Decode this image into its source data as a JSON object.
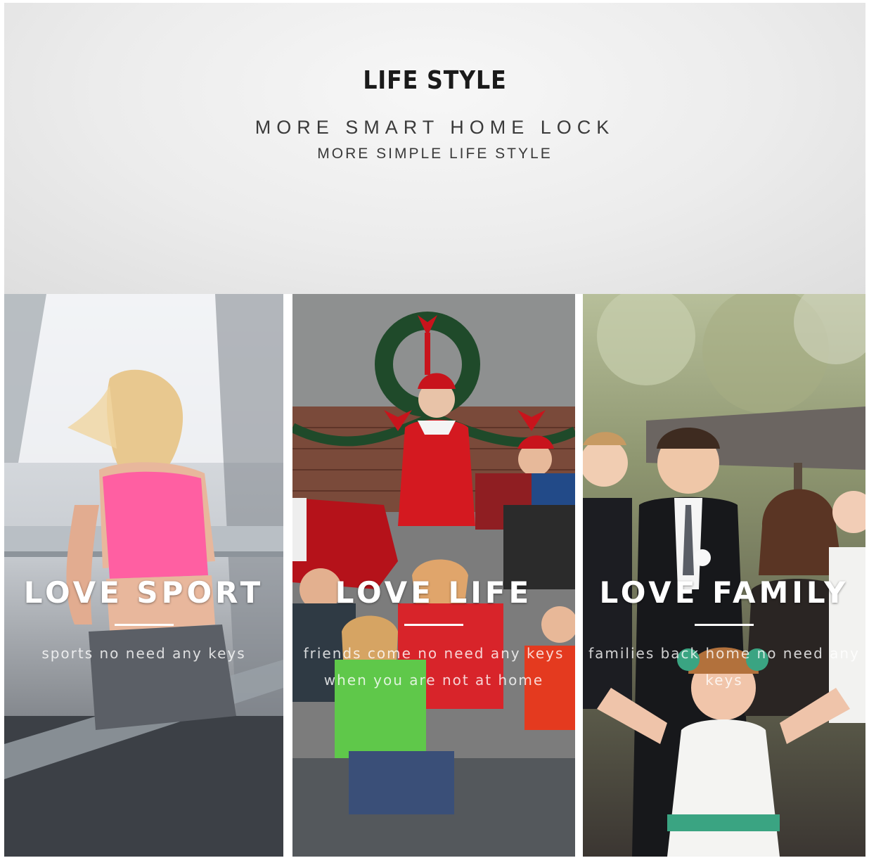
{
  "header": {
    "title": "LIFE STYLE",
    "subtitle": "MORE SMART HOME LOCK",
    "tagline": "MORE SIMPLE LIFE STYLE"
  },
  "panels": [
    {
      "label": "LOVE SPORT",
      "caption": "sports no need any keys"
    },
    {
      "label": "LOVE LIFE",
      "caption": "friends come no need any keys when you are not at home"
    },
    {
      "label": "LOVE FAMILY",
      "caption": "families back home no need any keys"
    }
  ],
  "colors": {
    "header_bg": "#ececec",
    "title_text": "#1a1a1a",
    "overlay_text": "#ffffff"
  }
}
